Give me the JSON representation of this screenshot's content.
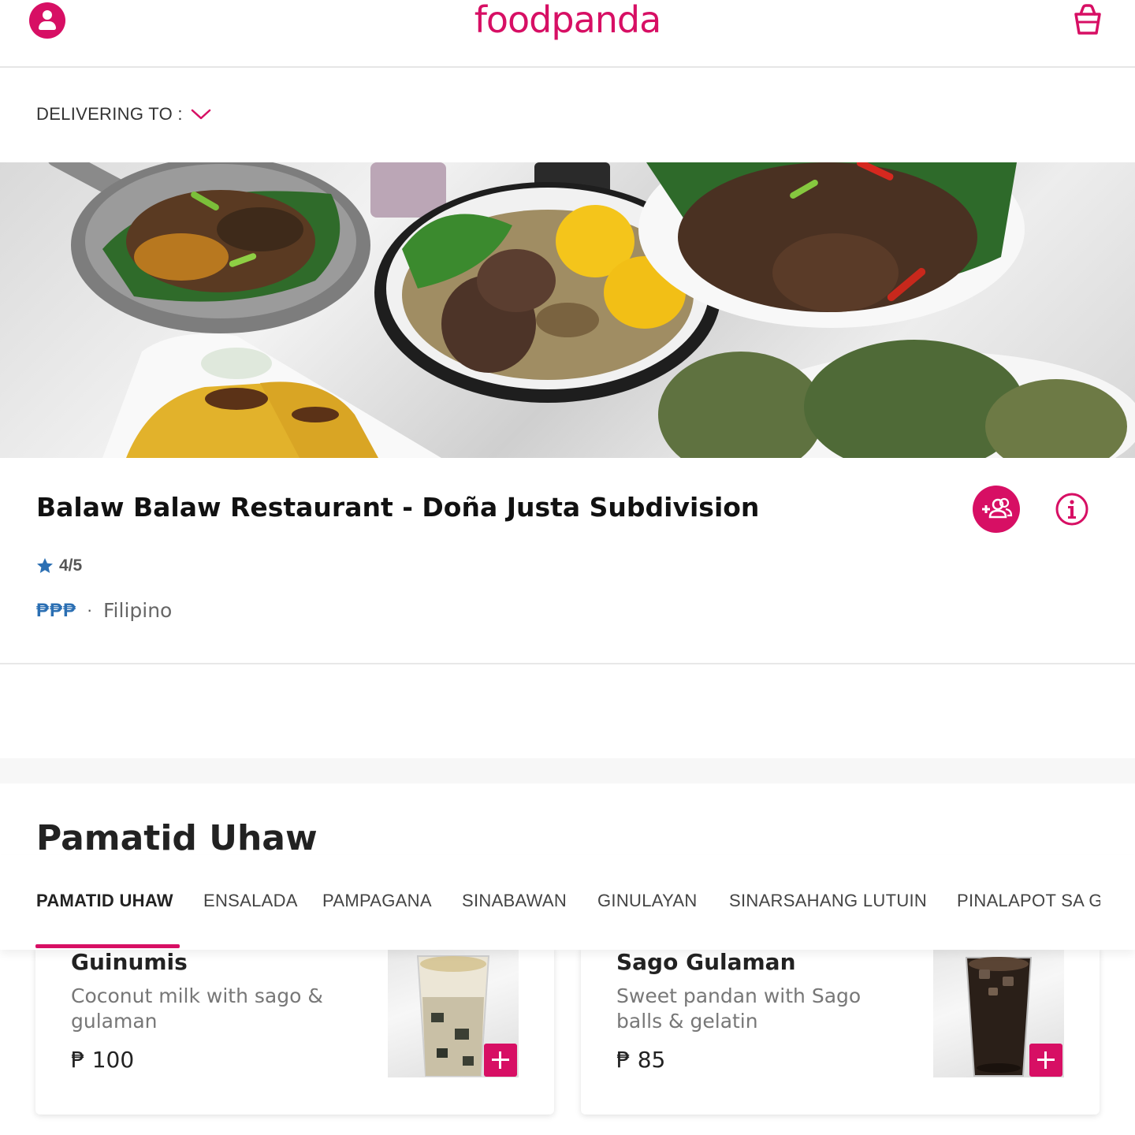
{
  "header": {
    "brand": "foodpanda",
    "account_icon": "user-icon",
    "cart_icon": "shopping-bag-icon",
    "accent_color": "#d70f64"
  },
  "delivery": {
    "label": "DELIVERING TO :",
    "chevron_icon": "chevron-down-icon"
  },
  "restaurant": {
    "name": "Balaw Balaw Restaurant - Doña Justa Subdivision",
    "rating": "4/5",
    "price_level": "₱₱₱",
    "separator": "·",
    "cuisine": "Filipino",
    "group_order_icon": "add-group-icon",
    "info_icon": "info-icon"
  },
  "menu": {
    "section_title": "Pamatid Uhaw",
    "tabs": [
      {
        "label": "PAMATID UHAW",
        "active": true
      },
      {
        "label": "ENSALADA",
        "active": false
      },
      {
        "label": "PAMPAGANA",
        "active": false
      },
      {
        "label": "SINABAWAN",
        "active": false
      },
      {
        "label": "GINULAYAN",
        "active": false
      },
      {
        "label": "SINARSAHANG LUTUIN",
        "active": false
      },
      {
        "label": "PINALAPOT SA GATA",
        "active": false
      }
    ],
    "items": [
      {
        "name": "Guinumis",
        "description": "Coconut milk with sago & gulaman",
        "price": "₱ 100"
      },
      {
        "name": "Sago Gulaman",
        "description": "Sweet pandan with Sago balls & gelatin",
        "price": "₱ 85"
      }
    ]
  }
}
